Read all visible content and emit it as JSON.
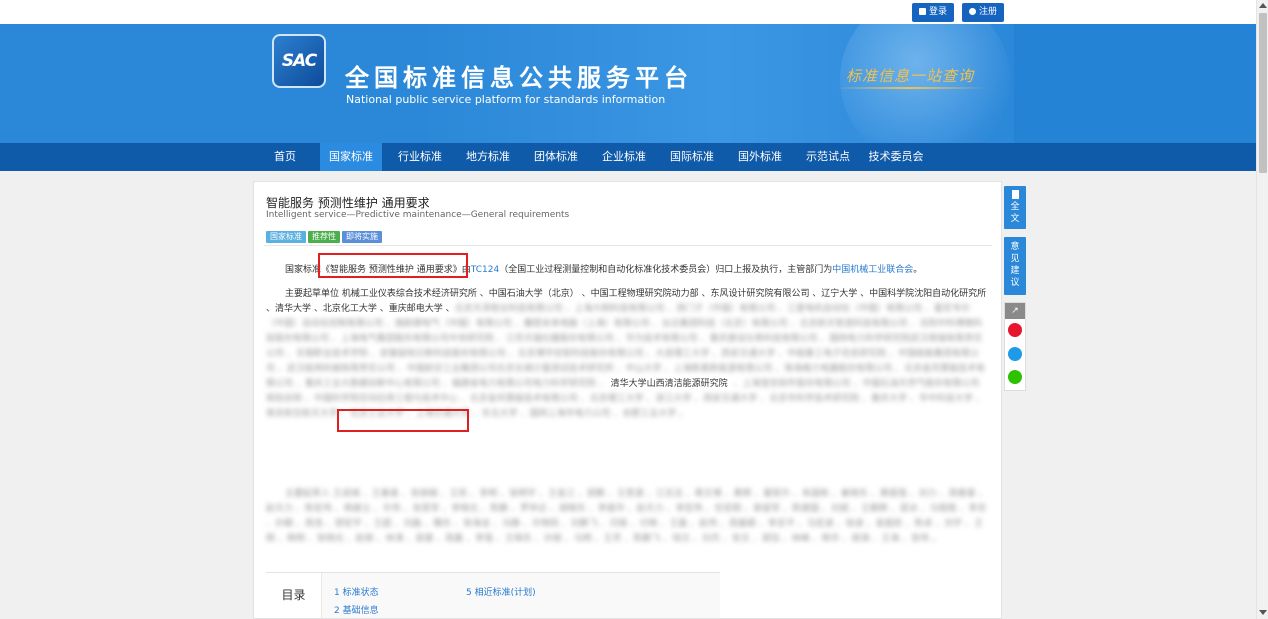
{
  "topbar": {
    "login_label": "登录",
    "register_label": "注册"
  },
  "banner": {
    "logo_text": "SAC",
    "title_cn": "全国标准信息公共服务平台",
    "title_en": "National public service platform  for standards information",
    "slogan": "标准信息一站查询"
  },
  "nav": {
    "items": [
      "首页",
      "国家标准",
      "行业标准",
      "地方标准",
      "团体标准",
      "企业标准",
      "国际标准",
      "国外标准",
      "示范试点",
      "技术委员会"
    ],
    "active": "国家标准"
  },
  "standard": {
    "title_cn": "智能服务 预测性维护 通用要求",
    "title_en": "Intelligent service—Predictive maintenance—General requirements",
    "badges": [
      {
        "label": "国家标准",
        "color": "#5bb0e0"
      },
      {
        "label": "推荐性",
        "color": "#4cae4c"
      },
      {
        "label": "即将实施",
        "color": "#5b8fd9"
      }
    ]
  },
  "para1": {
    "prefix": "国家标准",
    "std_name": "《智能服务 预测性维护 通用要求》",
    "by": "由",
    "tc": "TC124",
    "mid": "（全国工业过程测量控制和自动化标准化技术委员会）归口上报及执行，主管部门为",
    "dept": "中国机械工业联合会",
    "end": "。"
  },
  "para2": {
    "clear_text": "主要起草单位 机械工业仪表综合技术经济研究所 、中国石油大学（北京） 、中国工程物理研究院动力部 、东风设计研究院有限公司 、辽宁大学 、中国科学院沈阳自动化研究所 、清华大学 、北京化工大学 、重庆邮电大学 、",
    "blurred_text": "北京天泽智云科技有限公司 、上海大制科技有限公司 、西门子（中国）有限公司 、三菱电机自动化（中国）有限公司 、霍尼韦尔（中国）自动化控制有限公司 、施耐德电气（中国）有限公司 、魔搭未来电脑（上海）有限公司 、台达集团科技（北京）有限公司 、北京航天智造科技有限公司 、沈阳中科博微科技股份有限公司 、上海电气集团股份有限公司中央研究院 、江苏天瑞仪器股份有限公司 、华为技术有限公司 、重庆建设仪表科技有限公司 、国网电力科学研究院武汉南瑞有限责任公司 、无锡职业技术学院 、安徽容知日新科技股份有限公司 、北京博华信智科技股份有限公司 、大连理工大学 、西安交通大学 、中船重工电子信息研究院 、中国船舶集团有限公司 、武汉船用机械有限责任公司 、中国航空工业集团公司北京长城计量测试技术研究所 、中山大学 、上海新奥新能源有限公司 、珠海格力电器股份有限公司 、北京金风慧能技术有限公司 、重庆工业大数据创新中心有限公司 、福建省电力有限公司电力科学研究院 、",
    "highlight": "清华大学山西清洁能源研究院",
    "blurred_tail": " 、上海宝信软件股份有限公司 、中国石油天然气股份有限公司规划总院 、中国科学院空间应用工程与技术中心 、北京金风慧能技术有限公司 、北京理工大学 、浙江大学 、西安交通大学 、北京市科学技术研究院 、重庆大学 、华中科技大学 、南京航空航天大学 、北京工业大学 、上海交通大学 、东北大学 、国网上海市电力公司 、合肥工业大学 。"
  },
  "para3": {
    "blurred_text": "主要起草人 王成城 、王春喜 、张丽娟 、王凯 、李明 、徐明宇 、王金江 、郭鹏 、王思源 、江志洁 、蒋文博 、黄辉 、董智升 、朱国栋 、秦晓东 、黄振强 、刘力 、周春雷 、赵天力 、陈宏伟 、杨建立 、许伟 、张思军 、李晓光 、陈鹏 、罗仲达 、胡晓东 、李振华 、赵天力 、李宏伟 、任宏刚 、柴留军 、陈建国 、刘斌 、王朝辉 、梁冰 、马程程 、李忠 、孙朝 、周浩 、郭宏宇 、王超 、刘磊 、魏东 、张海龙 、冯静 、许晓阳 、刘鹏飞 、闫俊 、付晓 、王磊 、赵伟 、周嘉颖 、李亚平 、马宏波 、徐波 、袁振民 、陈卓 、刘宇 、王刚 、杨明 、张晓光 、赵丽 、林涛 、吴健 、周鑫 、李强 、王晓东 、孙丽 、马明 、王芳 、陈鹏飞 、钱文 、刘杰 、张文 、梁钰 、林峰 、杨华 、胡涛 、王海 、张伟 。"
  },
  "toc": {
    "label": "目录",
    "items": [
      "1 标准状态",
      "2 基础信息",
      "5 相近标准(计划)"
    ]
  },
  "side": {
    "fulltext": "全文",
    "feedback": "意见建议"
  }
}
